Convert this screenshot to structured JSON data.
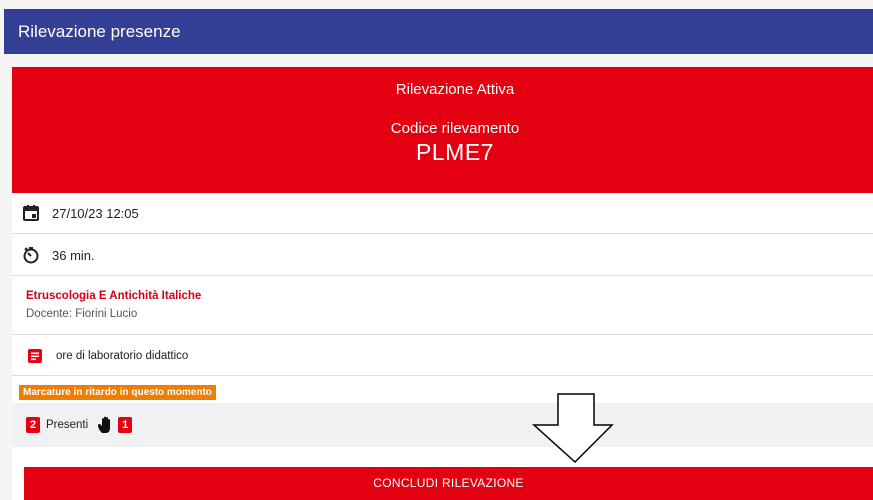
{
  "appbar": {
    "title": "Rilevazione presenze"
  },
  "banner": {
    "status": "Rilevazione Attiva",
    "code_label": "Codice rilevamento",
    "code": "PLME7"
  },
  "details": {
    "datetime": "27/10/23 12:05",
    "duration": "36 min.",
    "course_title": "Etruscologia E Antichità Italiche",
    "teacher": "Docente: Fiorini Lucio",
    "activity_type": "ore di laboratorio didattico"
  },
  "attendance": {
    "late_notice": "Marcature in ritardo in questo momento",
    "present_count": "2",
    "present_label": "Presenti",
    "raised_hand_count": "1"
  },
  "actions": {
    "conclude_label": "CONCLUDI RILEVAZIONE"
  },
  "icons": {
    "date": "calendar-icon",
    "duration": "timer-icon",
    "activity": "document-icon",
    "raised_hand": "hand-icon",
    "pointer": "down-arrow-icon"
  },
  "colors": {
    "appbar": "#333f94",
    "banner": "#e30010",
    "late_badge": "#f07c00",
    "course_title": "#d10018"
  }
}
